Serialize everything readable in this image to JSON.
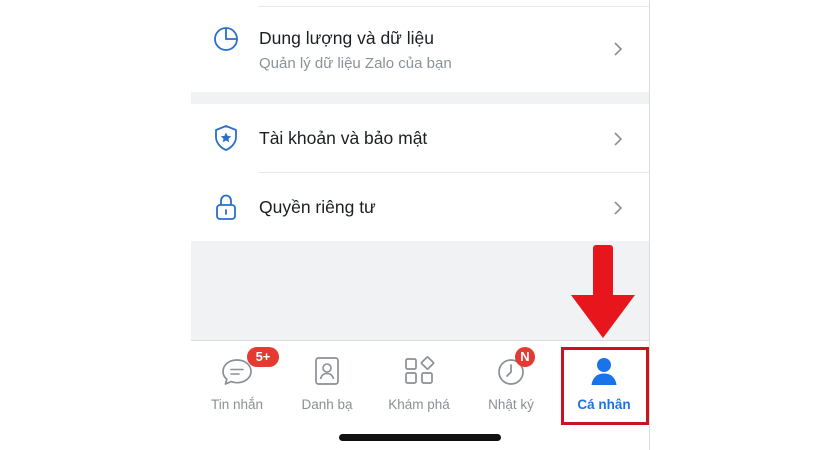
{
  "settings": {
    "storage": {
      "title": "Dung lượng và dữ liệu",
      "subtitle": "Quản lý dữ liệu Zalo của bạn",
      "icon": "pie-chart-icon"
    },
    "account_security": {
      "title": "Tài khoản và bảo mật",
      "icon": "shield-icon"
    },
    "privacy": {
      "title": "Quyền riêng tư",
      "icon": "lock-icon"
    }
  },
  "tabbar": {
    "tabs": [
      {
        "label": "Tin nhắn",
        "icon": "chat-icon",
        "badge": "5+"
      },
      {
        "label": "Danh bạ",
        "icon": "contacts-icon"
      },
      {
        "label": "Khám phá",
        "icon": "discover-icon"
      },
      {
        "label": "Nhật ký",
        "icon": "clock-icon",
        "badge": "N"
      },
      {
        "label": "Cá nhân",
        "icon": "person-icon",
        "active": true
      }
    ]
  },
  "colors": {
    "accent": "#1a73e8",
    "badge": "#e53a32",
    "annotation": "#e8161c"
  }
}
